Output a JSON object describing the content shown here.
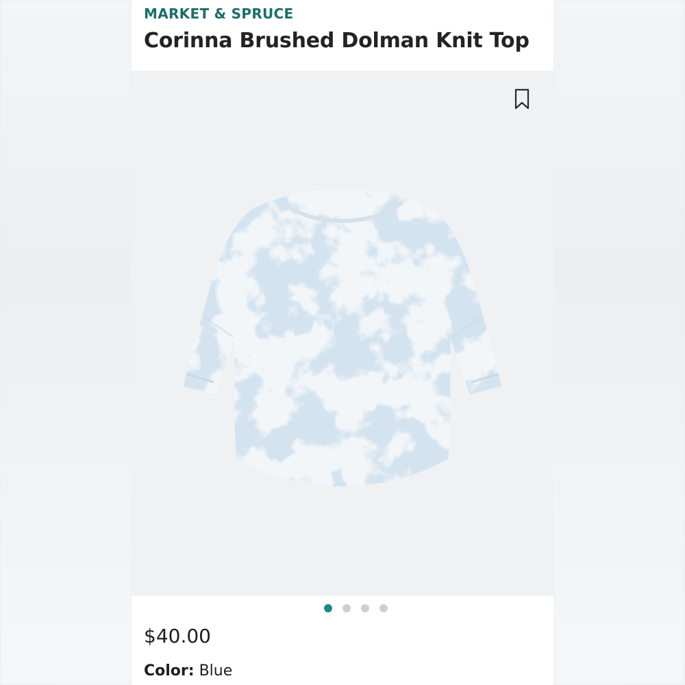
{
  "product": {
    "brand": "MARKET & SPRUCE",
    "title": "Corinna Brushed Dolman Knit Top",
    "price": "$40.00",
    "color_label": "Color:",
    "color_value": "Blue"
  },
  "carousel": {
    "dot_count": 4,
    "active_index": 0
  },
  "colors": {
    "brand_accent": "#1b6e69",
    "dot_active": "#1b8a83",
    "dot_inactive": "#cfcfcf",
    "tie_dye_blue": "#a9c4dd",
    "tie_dye_white": "#f3f6f8"
  },
  "icons": {
    "bookmark": "bookmark-icon"
  }
}
